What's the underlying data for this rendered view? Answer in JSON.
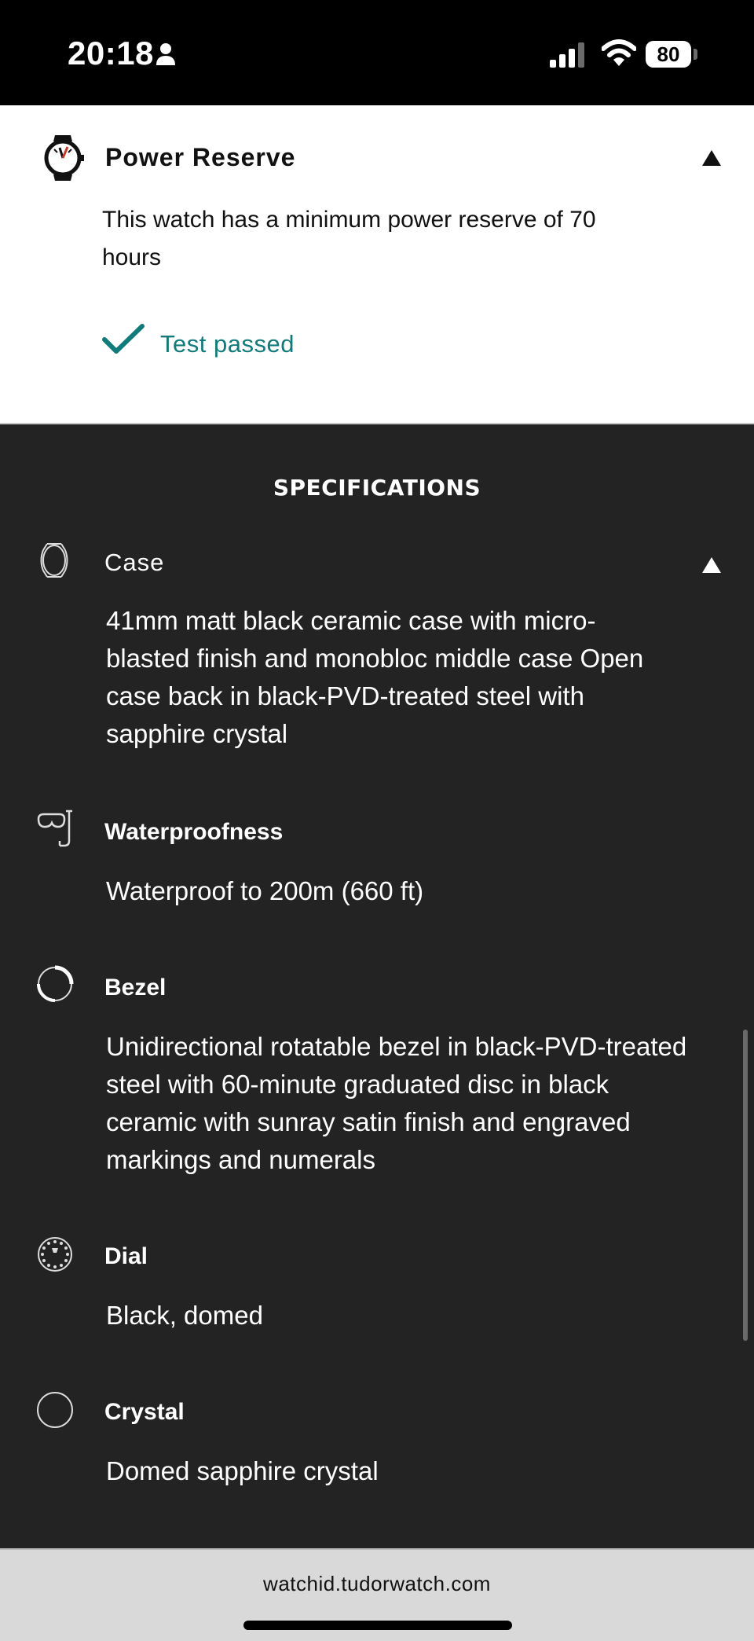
{
  "status_bar": {
    "time": "20:18",
    "battery": "80",
    "icons": [
      "person-icon",
      "signal-icon",
      "wifi-icon",
      "battery-icon"
    ]
  },
  "power_reserve": {
    "icon": "watch-power-icon",
    "title": "Power Reserve",
    "description": "This watch has a minimum power reserve of 70 hours",
    "status": "Test passed",
    "status_color": "#117a7a"
  },
  "specifications": {
    "heading": "SPECIFICATIONS",
    "items": [
      {
        "icon": "watch-case-icon",
        "title": "Case",
        "body": "41mm matt black ceramic case with micro-blasted finish and monobloc middle case Open case back in black-PVD-treated steel with sapphire crystal"
      },
      {
        "icon": "diving-mask-icon",
        "title": "Waterproofness",
        "body": "Waterproof to 200m (660 ft)"
      },
      {
        "icon": "bezel-icon",
        "title": "Bezel",
        "body": "Unidirectional rotatable bezel in black-PVD-treated steel with 60-minute graduated disc in black ceramic with sunray satin finish and engraved markings and numerals"
      },
      {
        "icon": "dial-icon",
        "title": "Dial",
        "body": "Black, domed"
      },
      {
        "icon": "crystal-icon",
        "title": "Crystal",
        "body": "Domed sapphire crystal"
      }
    ]
  },
  "browser": {
    "url": "watchid.tudorwatch.com"
  },
  "colors": {
    "background": "#232323",
    "card": "#ffffff",
    "accent": "#117a7a"
  }
}
